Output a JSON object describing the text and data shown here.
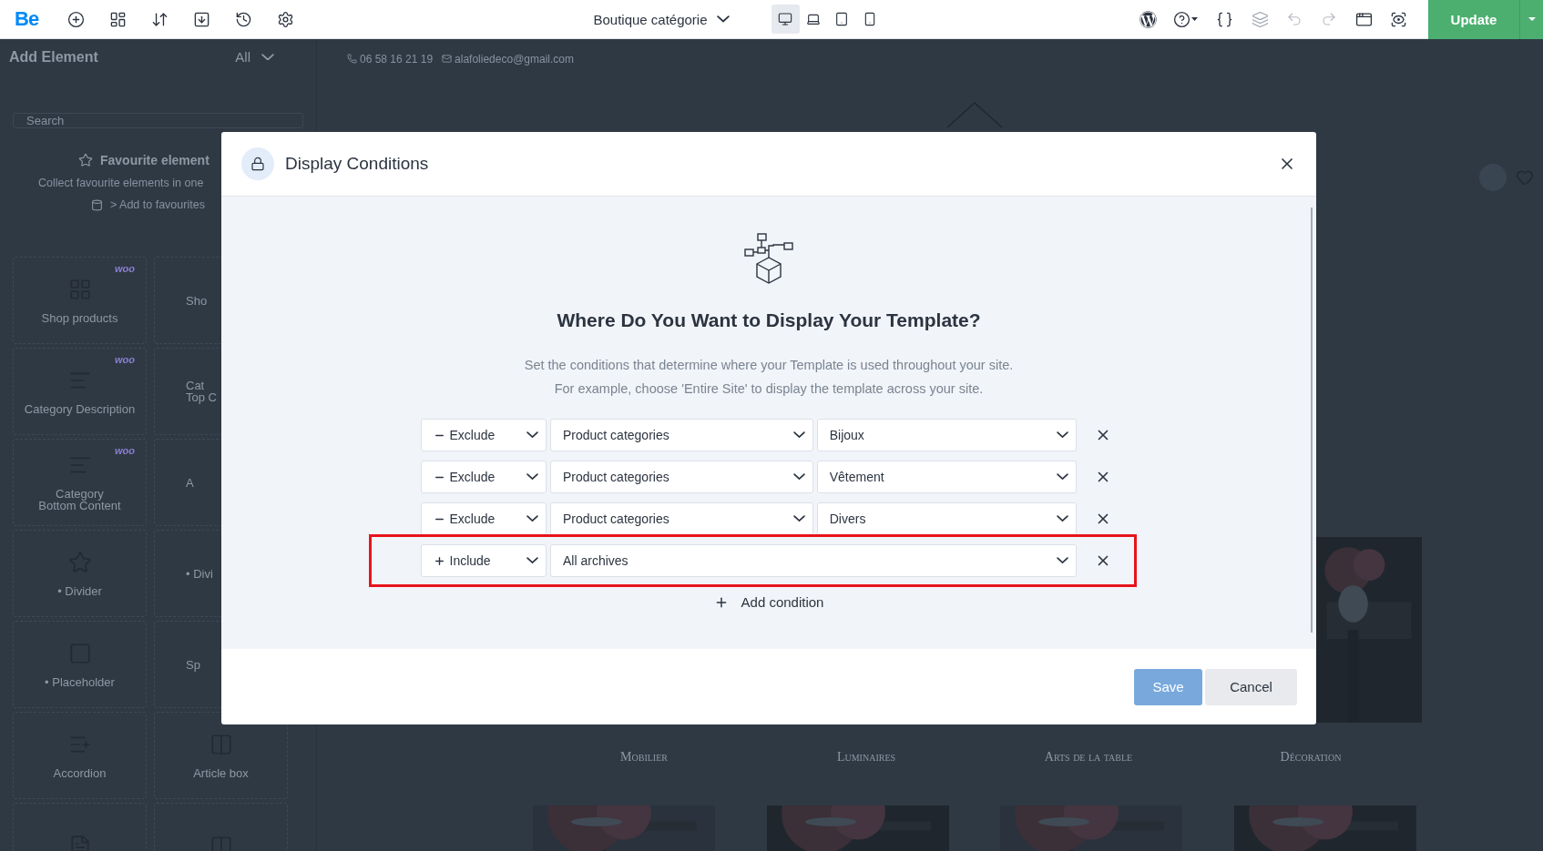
{
  "toolbar": {
    "logo": "Be",
    "template_name": "Boutique catégorie",
    "devices": [
      {
        "kind": "desktop",
        "selected": true
      },
      {
        "kind": "laptop",
        "selected": false
      },
      {
        "kind": "tablet",
        "selected": false
      },
      {
        "kind": "mobile",
        "selected": false
      }
    ],
    "update_button": "Update"
  },
  "sidebar": {
    "title": "Add Element",
    "filter": "All",
    "search_placeholder": "Search",
    "favourites": {
      "title": "Favourite element",
      "description": "Collect favourite elements in one",
      "hint": "> Add to favourites"
    },
    "elements": [
      {
        "kind": "products",
        "label": "Shop products",
        "badge": "woo"
      },
      {
        "kind": "products",
        "label": "Sho",
        "clipped": true
      },
      {
        "kind": "lines",
        "label": "Category Description",
        "badge": "woo"
      },
      {
        "kind": "lines",
        "label": "Cat\nTop C",
        "clipped": true
      },
      {
        "kind": "lines",
        "label": "Category\nBottom Content",
        "badge": "woo"
      },
      {
        "kind": "triangle",
        "label": "A",
        "clipped": true
      },
      {
        "kind": "divider",
        "label": "• Divider"
      },
      {
        "kind": "divider",
        "label": "• Divi",
        "clipped": true
      },
      {
        "kind": "placeholder",
        "label": "• Placeholder"
      },
      {
        "kind": "lines",
        "label": "Sp",
        "clipped": true
      },
      {
        "kind": "list",
        "label": "Accordion"
      },
      {
        "kind": "box",
        "label": "Article box"
      },
      {
        "kind": "text"
      },
      {
        "kind": "columns"
      }
    ]
  },
  "canvas": {
    "phone": "06 58 16 21 19",
    "email": "alafoliedeco@gmail.com",
    "categories": [
      "Mobilier",
      "Luminaires",
      "Arts de la table",
      "Décoration"
    ]
  },
  "modal": {
    "title": "Display Conditions",
    "heading": "Where Do You Want to Display Your Template?",
    "description": [
      "Set the conditions that determine where your Template is used throughout your site.",
      "For example, choose 'Entire Site' to display the template across your site."
    ],
    "conditions": [
      {
        "kind": "exclude",
        "mode": "Exclude",
        "type": "Product categories",
        "value": "Bijoux",
        "highlighted": false
      },
      {
        "kind": "exclude",
        "mode": "Exclude",
        "type": "Product categories",
        "value": "Vêtement",
        "highlighted": false
      },
      {
        "kind": "exclude",
        "mode": "Exclude",
        "type": "Product categories",
        "value": "Divers",
        "highlighted": false
      },
      {
        "kind": "include",
        "mode": "Include",
        "type": "All archives",
        "highlighted": true
      }
    ],
    "add_button": "Add condition",
    "save_button": "Save",
    "cancel_button": "Cancel"
  }
}
